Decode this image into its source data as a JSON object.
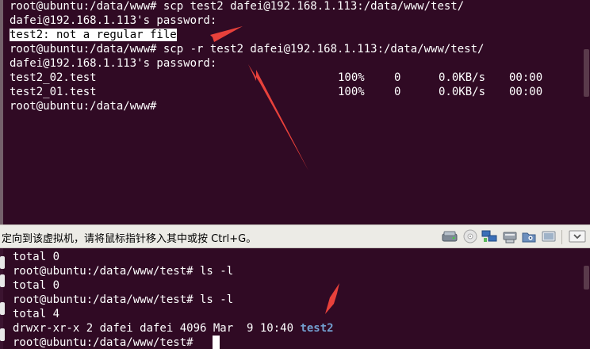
{
  "top_terminal": {
    "lines": [
      "root@ubuntu:/data/www# scp test2 dafei@192.168.1.113:/data/www/test/",
      "dafei@192.168.1.113's password:",
      "test2: not a regular file",
      "root@ubuntu:/data/www# scp -r test2 dafei@192.168.1.113:/data/www/test/",
      "dafei@192.168.1.113's password:"
    ],
    "transfers": [
      {
        "file": "test2_02.test",
        "percent": "100%",
        "size": "0",
        "rate": "0.0KB/s",
        "eta": "00:00"
      },
      {
        "file": "test2_01.test",
        "percent": "100%",
        "size": "0",
        "rate": "0.0KB/s",
        "eta": "00:00"
      }
    ],
    "last_prompt": "root@ubuntu:/data/www#"
  },
  "vbox_status": {
    "message": "定向到该虚拟机，请将鼠标指针移入其中或按 Ctrl+G。",
    "icons": [
      "hard-disk-icon",
      "optical-disk-icon",
      "network-icon",
      "usb-icon",
      "shared-folders-icon",
      "video-capture-icon",
      "display-icon",
      "arrow-down-icon"
    ]
  },
  "bottom_terminal": {
    "lines": [
      "total 0",
      "root@ubuntu:/data/www/test# ls -l",
      "total 0",
      "root@ubuntu:/data/www/test# ls -l",
      "total 4"
    ],
    "dir_entry_prefix": "drwxr-xr-x 2 dafei dafei 4096 Mar  9 10:40 ",
    "dir_entry_name": "test2",
    "final_prompt": "root@ubuntu:/data/www/test# "
  },
  "colors": {
    "terminal_bg": "#300a24",
    "annotation_arrow": "#e8413b",
    "directory_name": "#729fcf"
  }
}
